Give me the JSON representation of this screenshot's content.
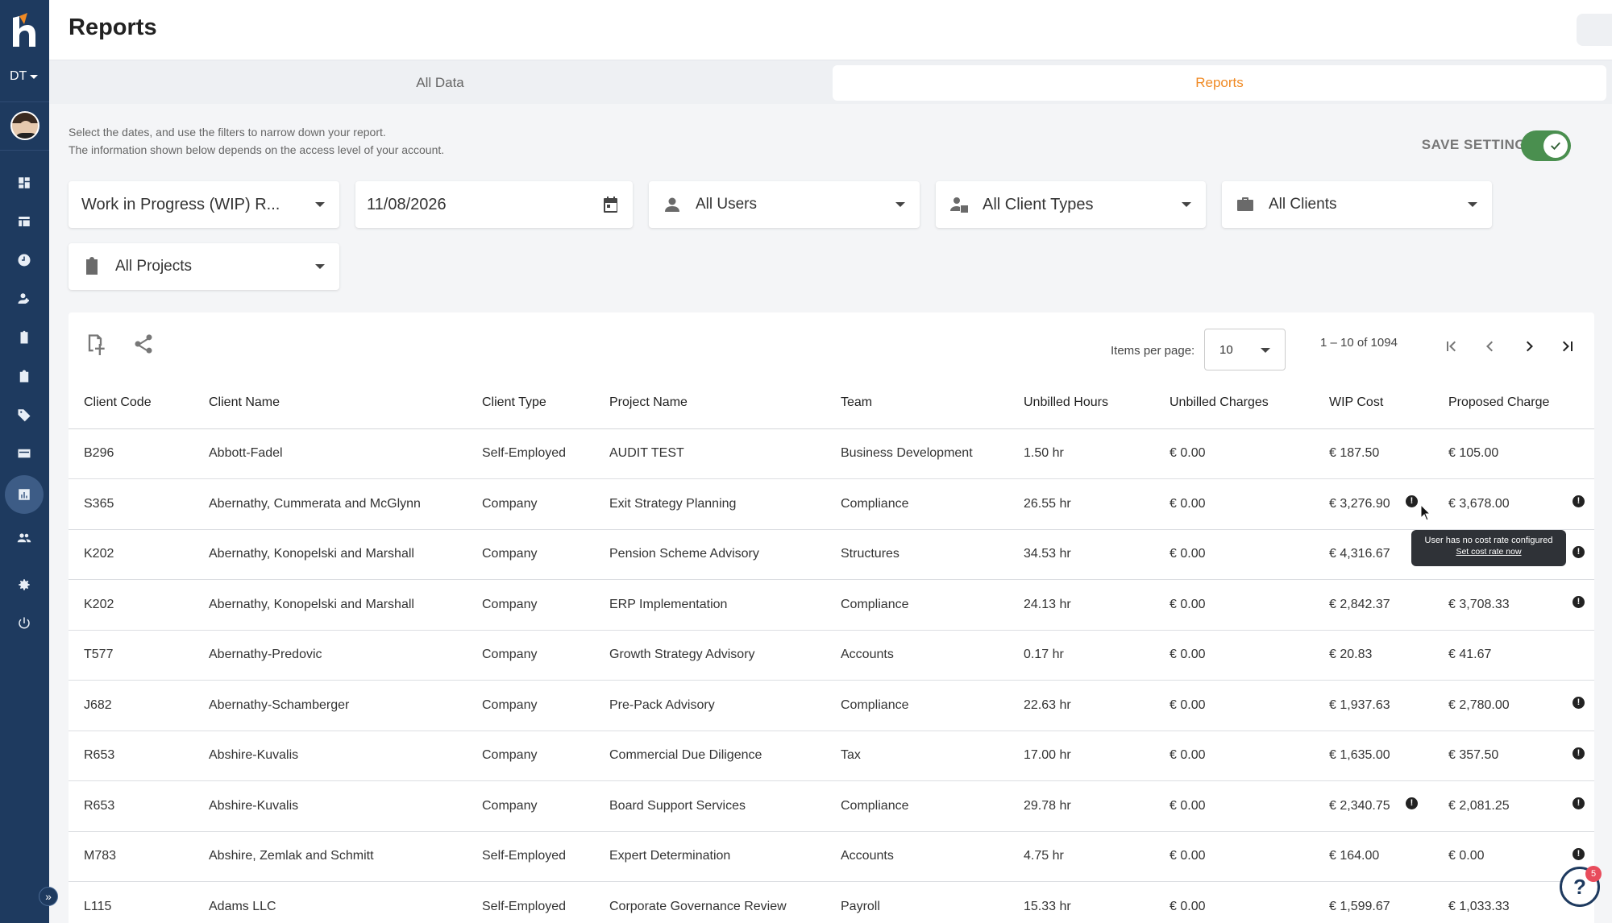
{
  "app": {
    "page_title": "Reports"
  },
  "sidebar": {
    "workspace": "DT",
    "items": [
      "dashboard-icon",
      "table-icon",
      "clock-icon",
      "user-manage-icon",
      "clipboard-icon",
      "clipboard-alt-icon",
      "tag-icon",
      "card-icon",
      "chart-icon",
      "team-icon",
      "gear-icon",
      "power-icon"
    ]
  },
  "tabs": [
    {
      "label": "All Data",
      "active": false
    },
    {
      "label": "Reports",
      "active": true
    }
  ],
  "info": {
    "line1": "Select the dates, and use the filters to narrow down your report.",
    "line2": "The information shown below depends on the access level of your account."
  },
  "save_settings": {
    "label": "SAVE SETTINGS",
    "enabled": true
  },
  "filters": {
    "report_type": "Work in Progress (WIP) R...",
    "date": "11/08/2026",
    "users": "All Users",
    "client_types": "All Client Types",
    "clients": "All Clients",
    "projects": "All Projects"
  },
  "pagination": {
    "items_per_page_label": "Items per page:",
    "items_per_page": "10",
    "range": "1 – 10 of 1094"
  },
  "table": {
    "columns": [
      "Client Code",
      "Client Name",
      "Client Type",
      "Project Name",
      "Team",
      "Unbilled Hours",
      "Unbilled Charges",
      "WIP Cost",
      "Proposed Charge"
    ],
    "rows": [
      {
        "code": "B296",
        "name": "Abbott-Fadel",
        "type": "Self-Employed",
        "project": "AUDIT TEST",
        "team": "Business Development",
        "hours": "1.50 hr",
        "charges": "€ 0.00",
        "wip": "€ 187.50",
        "proposed": "€ 105.00",
        "wip_alert": false,
        "row_alert": false
      },
      {
        "code": "S365",
        "name": "Abernathy, Cummerata and McGlynn",
        "type": "Company",
        "project": "Exit Strategy Planning",
        "team": "Compliance",
        "hours": "26.55 hr",
        "charges": "€ 0.00",
        "wip": "€ 3,276.90",
        "proposed": "€ 3,678.00",
        "wip_alert": true,
        "row_alert": true
      },
      {
        "code": "K202",
        "name": "Abernathy, Konopelski and Marshall",
        "type": "Company",
        "project": "Pension Scheme Advisory",
        "team": "Structures",
        "hours": "34.53 hr",
        "charges": "€ 0.00",
        "wip": "€ 4,316.67",
        "proposed": "",
        "wip_alert": false,
        "row_alert": true
      },
      {
        "code": "K202",
        "name": "Abernathy, Konopelski and Marshall",
        "type": "Company",
        "project": "ERP Implementation",
        "team": "Compliance",
        "hours": "24.13 hr",
        "charges": "€ 0.00",
        "wip": "€ 2,842.37",
        "proposed": "€ 3,708.33",
        "wip_alert": false,
        "row_alert": true
      },
      {
        "code": "T577",
        "name": "Abernathy-Predovic",
        "type": "Company",
        "project": "Growth Strategy Advisory",
        "team": "Accounts",
        "hours": "0.17 hr",
        "charges": "€ 0.00",
        "wip": "€ 20.83",
        "proposed": "€ 41.67",
        "wip_alert": false,
        "row_alert": false
      },
      {
        "code": "J682",
        "name": "Abernathy-Schamberger",
        "type": "Company",
        "project": "Pre-Pack Advisory",
        "team": "Compliance",
        "hours": "22.63 hr",
        "charges": "€ 0.00",
        "wip": "€ 1,937.63",
        "proposed": "€ 2,780.00",
        "wip_alert": false,
        "row_alert": true
      },
      {
        "code": "R653",
        "name": "Abshire-Kuvalis",
        "type": "Company",
        "project": "Commercial Due Diligence",
        "team": "Tax",
        "hours": "17.00 hr",
        "charges": "€ 0.00",
        "wip": "€ 1,635.00",
        "proposed": "€ 357.50",
        "wip_alert": false,
        "row_alert": true
      },
      {
        "code": "R653",
        "name": "Abshire-Kuvalis",
        "type": "Company",
        "project": "Board Support Services",
        "team": "Compliance",
        "hours": "29.78 hr",
        "charges": "€ 0.00",
        "wip": "€ 2,340.75",
        "proposed": "€ 2,081.25",
        "wip_alert": true,
        "row_alert": true
      },
      {
        "code": "M783",
        "name": "Abshire, Zemlak and Schmitt",
        "type": "Self-Employed",
        "project": "Expert Determination",
        "team": "Accounts",
        "hours": "4.75 hr",
        "charges": "€ 0.00",
        "wip": "€ 164.00",
        "proposed": "€ 0.00",
        "wip_alert": false,
        "row_alert": true
      },
      {
        "code": "L115",
        "name": "Adams LLC",
        "type": "Self-Employed",
        "project": "Corporate Governance Review",
        "team": "Payroll",
        "hours": "15.33 hr",
        "charges": "€ 0.00",
        "wip": "€ 1,599.67",
        "proposed": "€ 1,033.33",
        "wip_alert": false,
        "row_alert": false
      }
    ]
  },
  "tooltip": {
    "message": "User has no cost rate configured",
    "link": "Set cost rate now"
  },
  "help": {
    "badge": "5"
  },
  "colors": {
    "sidebar": "#1e3a5f",
    "accent": "#f08a24",
    "toggle_on": "#4a8f4f"
  }
}
